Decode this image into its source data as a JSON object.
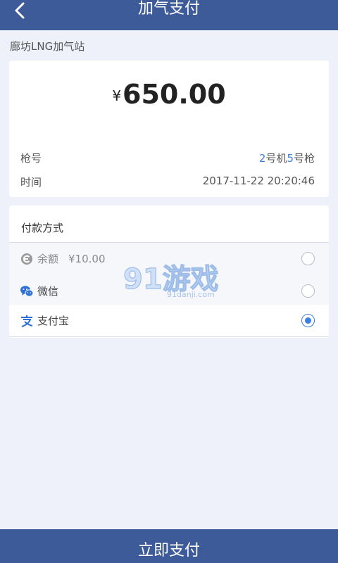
{
  "header": {
    "title": "加气支付"
  },
  "station": {
    "name": "廊坊LNG加气站"
  },
  "order": {
    "currency_symbol": "¥",
    "amount": "650.00",
    "gun_label": "枪号",
    "gun_machine_num": "2",
    "gun_machine_text": "号机",
    "gun_num": "5",
    "gun_text": "号枪",
    "time_label": "时间",
    "time_value": "2017-11-22 20:20:46"
  },
  "payment": {
    "title": "付款方式",
    "methods": [
      {
        "label": "余额",
        "extra": "¥10.00",
        "icon": "balance-icon",
        "selected": false,
        "disabled": true
      },
      {
        "label": "微信",
        "icon": "wechat-icon",
        "selected": false
      },
      {
        "label": "支付宝",
        "icon": "alipay-icon",
        "selected": true
      }
    ]
  },
  "watermark": {
    "brand": "91游戏",
    "site": "91danji.com"
  },
  "footer": {
    "submit_label": "立即支付"
  },
  "colors": {
    "primary": "#3d5a99",
    "accent": "#3d7fe0",
    "background": "#eef1f9"
  }
}
